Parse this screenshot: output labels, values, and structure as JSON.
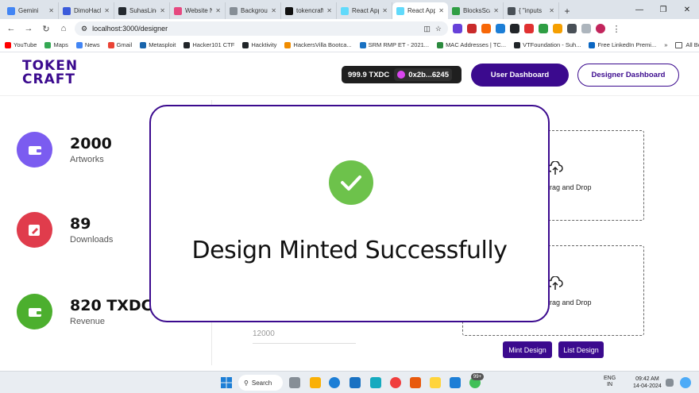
{
  "browser": {
    "tabs": [
      {
        "label": "Gemini",
        "color": "#4285f4"
      },
      {
        "label": "DimoHack",
        "color": "#3b5bdb"
      },
      {
        "label": "SuhasLing",
        "color": "#24292f"
      },
      {
        "label": "Website N",
        "color": "#e64980"
      },
      {
        "label": "Backgrou",
        "color": "#868e96"
      },
      {
        "label": "tokencraft",
        "color": "#111111"
      },
      {
        "label": "React App",
        "color": "#61dafb"
      },
      {
        "label": "React App",
        "color": "#61dafb",
        "active": true
      },
      {
        "label": "BlocksSca",
        "color": "#2f9e44"
      },
      {
        "label": "{ \"inputs",
        "color": "#495057"
      }
    ],
    "url": "localhost:3000/designer",
    "bookmarks": [
      {
        "label": "YouTube",
        "color": "#ff0000"
      },
      {
        "label": "Maps",
        "color": "#34a853"
      },
      {
        "label": "News",
        "color": "#4285f4"
      },
      {
        "label": "Gmail",
        "color": "#ea4335"
      },
      {
        "label": "Metasploit",
        "color": "#1864ab"
      },
      {
        "label": "Hacker101 CTF",
        "color": "#212529"
      },
      {
        "label": "Hacktivity",
        "color": "#212529"
      },
      {
        "label": "HackersVilla Bootca...",
        "color": "#f08c00"
      },
      {
        "label": "SRM RMP ET - 2021...",
        "color": "#1971c2"
      },
      {
        "label": "MAC Addresses | TC...",
        "color": "#2b8a3e"
      },
      {
        "label": "VTFoundation - Suh...",
        "color": "#212529"
      },
      {
        "label": "Free LinkedIn Premi...",
        "color": "#0a66c2"
      }
    ],
    "all_bookmarks": "All Bookmarks",
    "chevron": "»"
  },
  "header": {
    "logo_line1": "TOKEN",
    "logo_line2": "CRAFT",
    "balance": "999.9 TXDC",
    "address": "0x2b...6245",
    "user_dashboard": "User Dashboard",
    "designer_dashboard": "Designer Dashboard"
  },
  "stats": [
    {
      "value": "2000",
      "label": "Artworks",
      "color": "#7b5cf0"
    },
    {
      "value": "89",
      "label": "Downloads",
      "color": "#e03c4c"
    },
    {
      "value": "820 TXDC",
      "label": "Revenue",
      "color": "#4caf2e"
    }
  ],
  "form": {
    "price_value": "12000"
  },
  "uploads": [
    {
      "text": "or Drag and Drop"
    },
    {
      "text": "or Drag and Drop"
    }
  ],
  "actions": {
    "mint": "Mint Design",
    "list": "List Design"
  },
  "modal": {
    "message": "Design Minted Successfully",
    "accent": "#6dc24b",
    "border": "#3b0a8e"
  },
  "taskbar": {
    "search": "Search",
    "badge": "99+",
    "lang1": "ENG",
    "lang2": "IN",
    "time": "09:42 AM",
    "date": "14-04-2024"
  }
}
